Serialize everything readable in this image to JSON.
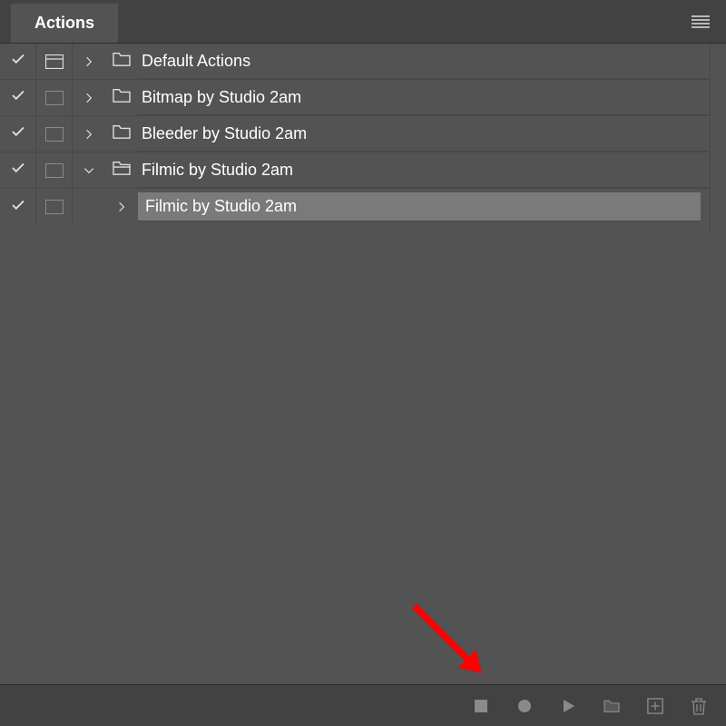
{
  "header": {
    "tab_label": "Actions"
  },
  "rows": [
    {
      "label": "Default Actions",
      "checked": true,
      "dialog": true,
      "expanded": false,
      "folder": true,
      "indent": 0,
      "selected": false
    },
    {
      "label": "Bitmap by Studio 2am",
      "checked": true,
      "dialog": false,
      "expanded": false,
      "folder": true,
      "indent": 0,
      "selected": false
    },
    {
      "label": "Bleeder by Studio 2am",
      "checked": true,
      "dialog": false,
      "expanded": false,
      "folder": true,
      "indent": 0,
      "selected": false
    },
    {
      "label": "Filmic by Studio 2am",
      "checked": true,
      "dialog": false,
      "expanded": true,
      "folder": true,
      "indent": 0,
      "selected": false
    },
    {
      "label": "Filmic by Studio 2am",
      "checked": true,
      "dialog": false,
      "expanded": false,
      "folder": false,
      "indent": 1,
      "selected": true
    }
  ],
  "toolbar": {
    "stop": "stop-icon",
    "record": "record-icon",
    "play": "play-icon",
    "new_set": "folder-icon",
    "new_action": "new-item-icon",
    "delete": "trash-icon"
  },
  "colors": {
    "bg": "#535353",
    "header_bg": "#424242",
    "text": "#ffffff",
    "icon": "#8a8a8a",
    "selected": "#7a7a7a",
    "annotation": "#ff0000"
  }
}
